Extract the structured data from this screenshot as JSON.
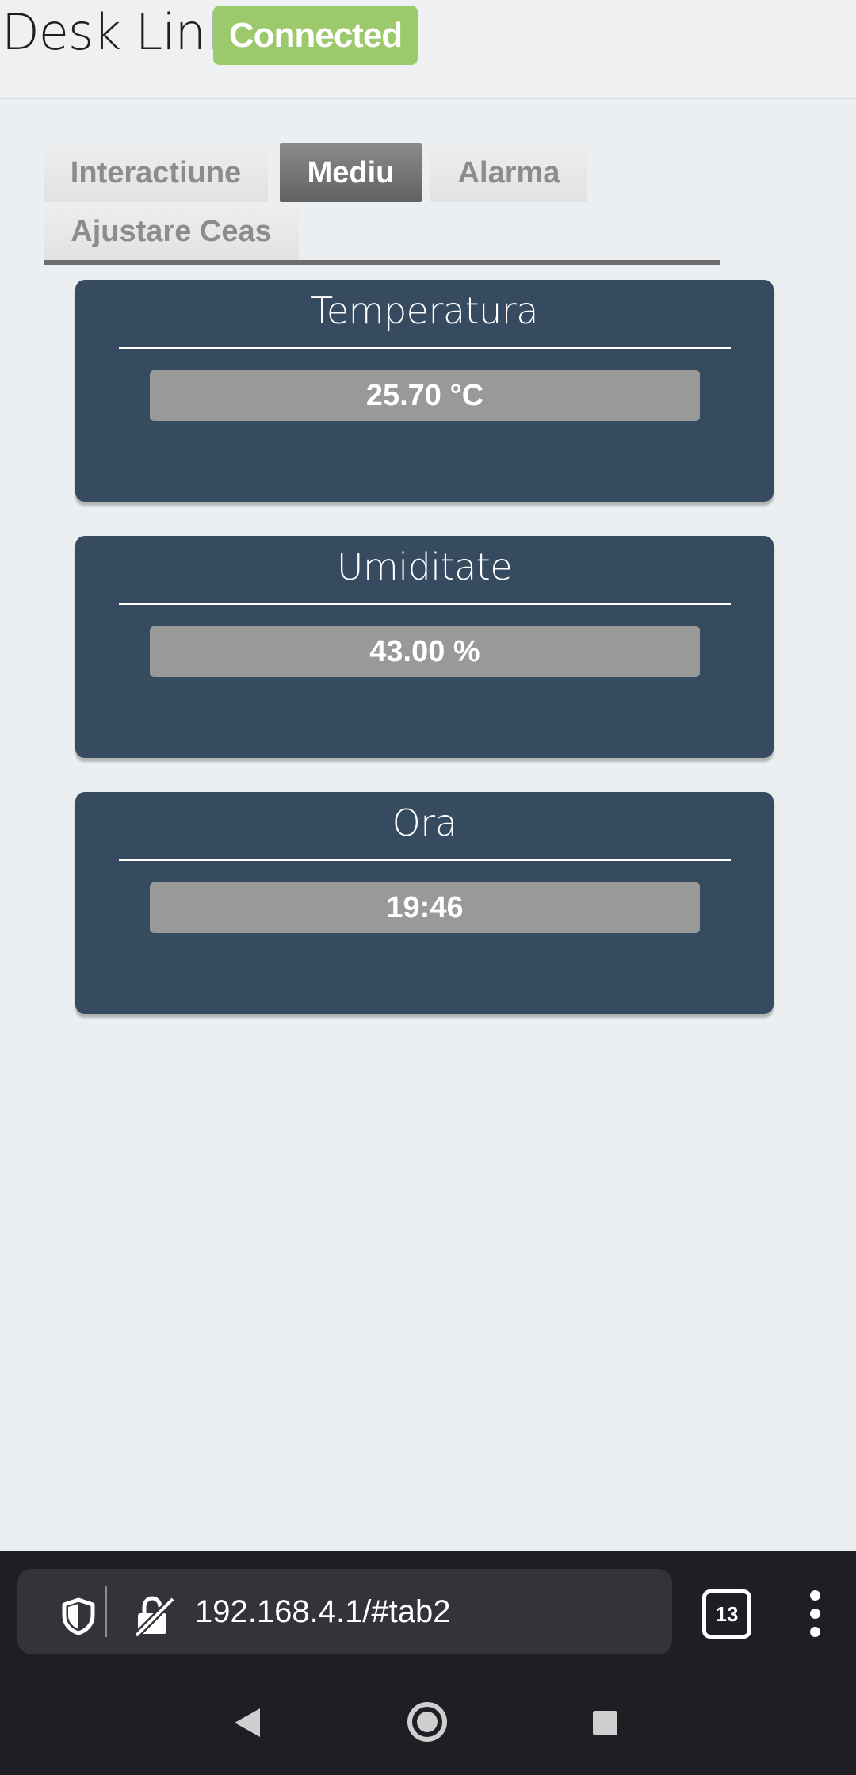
{
  "header": {
    "title": "Desk Link",
    "status": "Connected"
  },
  "tabs": [
    {
      "label": "Interactiune",
      "active": false
    },
    {
      "label": "Mediu",
      "active": true
    },
    {
      "label": "Alarma",
      "active": false
    },
    {
      "label": "Ajustare Ceas",
      "active": false
    }
  ],
  "cards": [
    {
      "title": "Temperatura",
      "value": "25.70 °C"
    },
    {
      "title": "Umiditate",
      "value": "43.00 %"
    },
    {
      "title": "Ora",
      "value": "19:46"
    }
  ],
  "browser": {
    "url": "192.168.4.1/#tab2",
    "tab_count": "13"
  },
  "colors": {
    "connected_badge": "#9cc96b",
    "card_background": "#364a60",
    "active_tab": "#707070",
    "value_box": "#999999"
  },
  "icons": {
    "shield": "shield-icon",
    "insecure": "lock-off-icon",
    "menu": "more-vertical-icon",
    "back": "nav-back-icon",
    "home": "nav-home-icon",
    "recent": "nav-recent-icon"
  }
}
